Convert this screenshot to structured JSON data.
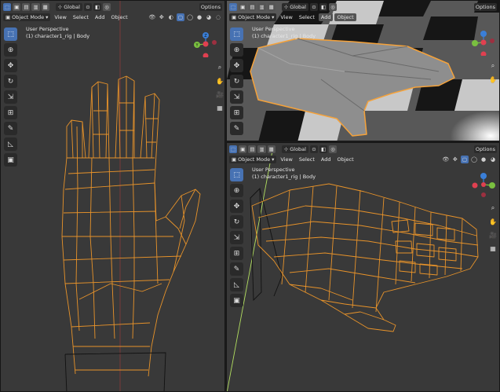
{
  "header": {
    "mode_label": "Object Mode",
    "menus": [
      "View",
      "Select",
      "Add",
      "Object"
    ],
    "transform_orientation": "Global",
    "options_label": "Options"
  },
  "viewports": {
    "left": {
      "perspective": "User Perspective",
      "object": "(1) character1_rig | Body"
    },
    "top_right": {
      "perspective": "User Perspective",
      "object": "(1) character1_rig | Body"
    },
    "bottom_right": {
      "perspective": "User Perspective",
      "object": "(1) character1_rig | Body"
    }
  },
  "tools": [
    "select-box-icon",
    "cursor-icon",
    "move-icon",
    "rotate-icon",
    "scale-icon",
    "transform-icon",
    "annotate-icon",
    "measure-icon",
    "add-cube-icon"
  ],
  "gizmo_axes": {
    "x": "X",
    "y": "Y",
    "z": "Z"
  },
  "colors": {
    "selection_orange": "#f5a23a",
    "wireframe_orange": "#e8932a",
    "active_blue": "#4772b3",
    "axis_red": "#e04050",
    "axis_green": "#7ac040",
    "axis_blue": "#3a7fd8",
    "y_axis_line": "#b3e060"
  }
}
